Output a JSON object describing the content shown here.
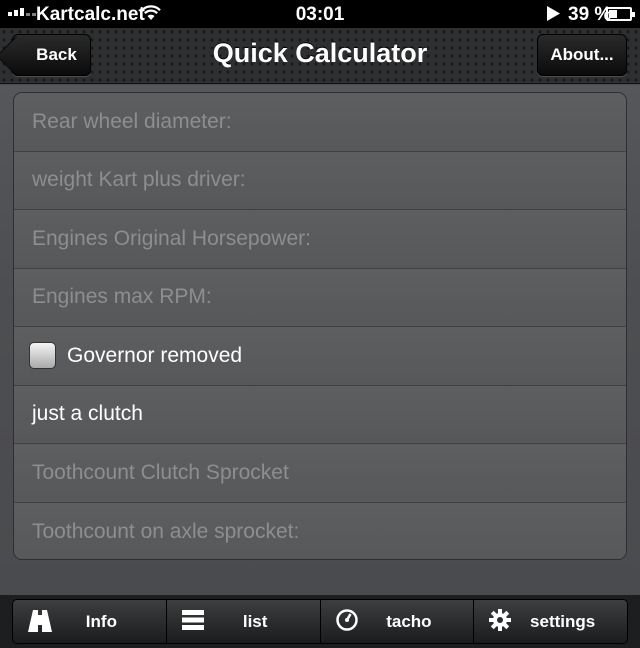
{
  "status_bar": {
    "carrier": "Kartcalc.net",
    "time": "03:01",
    "battery": "39 %",
    "battery_level": 0.39,
    "icons": [
      "signal-icon",
      "wifi-icon",
      "play-icon",
      "battery-icon"
    ]
  },
  "nav": {
    "title": "Quick Calculator",
    "back_label": "Back",
    "about_label": "About..."
  },
  "form": {
    "rear_wheel_placeholder": "Rear wheel diameter:",
    "weight_placeholder": "weight Kart plus driver:",
    "horsepower_placeholder": "Engines Original Horsepower:",
    "max_rpm_placeholder": "Engines max RPM:",
    "governor_label": "Governor removed",
    "governor_checked": false,
    "clutch_value": "just a clutch",
    "clutch_sprocket_placeholder": "Toothcount Clutch Sprocket",
    "axle_sprocket_placeholder": "Toothcount on axle sprocket:"
  },
  "tabs": [
    {
      "label": "Info",
      "icon": "road-icon"
    },
    {
      "label": "list",
      "icon": "list-icon"
    },
    {
      "label": "tacho",
      "icon": "tachometer-icon"
    },
    {
      "label": "settings",
      "icon": "gear-icon"
    }
  ],
  "colors": {
    "background": "#4a4b4e",
    "nav_bar": "#2e2f31",
    "placeholder_text": "#8d8e90",
    "value_text": "#ffffff"
  }
}
